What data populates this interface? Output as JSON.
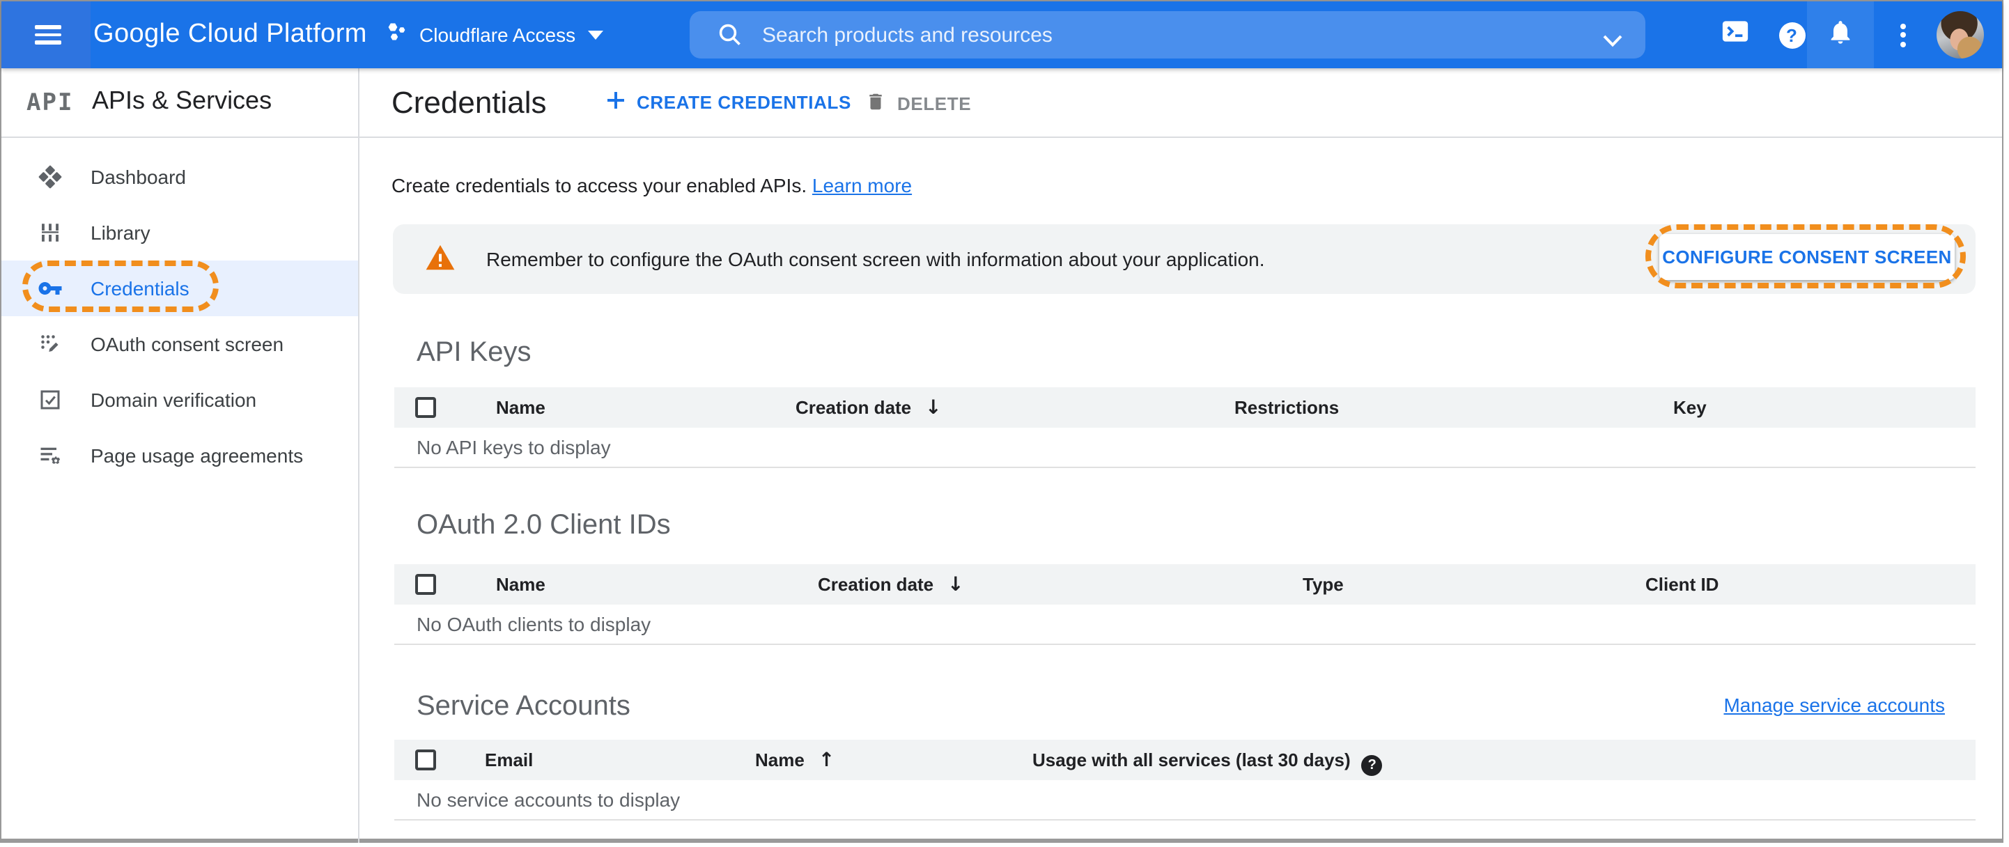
{
  "topbar": {
    "product_name": "Google Cloud Platform",
    "project_name": "Cloudflare Access",
    "search_placeholder": "Search products and resources"
  },
  "sidebar": {
    "logo_text": "API",
    "title": "APIs & Services",
    "items": [
      {
        "label": "Dashboard"
      },
      {
        "label": "Library"
      },
      {
        "label": "Credentials"
      },
      {
        "label": "OAuth consent screen"
      },
      {
        "label": "Domain verification"
      },
      {
        "label": "Page usage agreements"
      }
    ]
  },
  "page_header": {
    "title": "Credentials",
    "create_button": "CREATE CREDENTIALS",
    "delete_button": "DELETE"
  },
  "intro": {
    "text": "Create credentials to access your enabled APIs.",
    "link": "Learn more"
  },
  "warning_banner": {
    "message": "Remember to configure the OAuth consent screen with information about your application.",
    "action_button": "CONFIGURE CONSENT SCREEN"
  },
  "api_keys": {
    "title": "API Keys",
    "col_name": "Name",
    "col_creation_date": "Creation date",
    "col_restrictions": "Restrictions",
    "col_key": "Key",
    "empty_text": "No API keys to display"
  },
  "oauth_clients": {
    "title": "OAuth 2.0 Client IDs",
    "col_name": "Name",
    "col_creation_date": "Creation date",
    "col_type": "Type",
    "col_client_id": "Client ID",
    "empty_text": "No OAuth clients to display"
  },
  "service_accounts": {
    "title": "Service Accounts",
    "manage_link": "Manage service accounts",
    "col_email": "Email",
    "col_name": "Name",
    "col_usage": "Usage with all services (last 30 days)",
    "empty_text": "No service accounts to display"
  },
  "icons": {
    "question_glyph": "?",
    "sort_desc_glyph": "↓",
    "sort_asc_glyph": "↑"
  },
  "colors": {
    "topbar_blue": "#1a73e8",
    "search_field_blue": "#4a8fed",
    "selected_item_bg": "#e8f0fe",
    "link_blue": "#1a73e8",
    "annotation_orange": "#f18e1d",
    "warning_orange": "#e8710a",
    "banner_gray": "#f1f3f4",
    "table_header_gray": "#f1f3f4"
  }
}
